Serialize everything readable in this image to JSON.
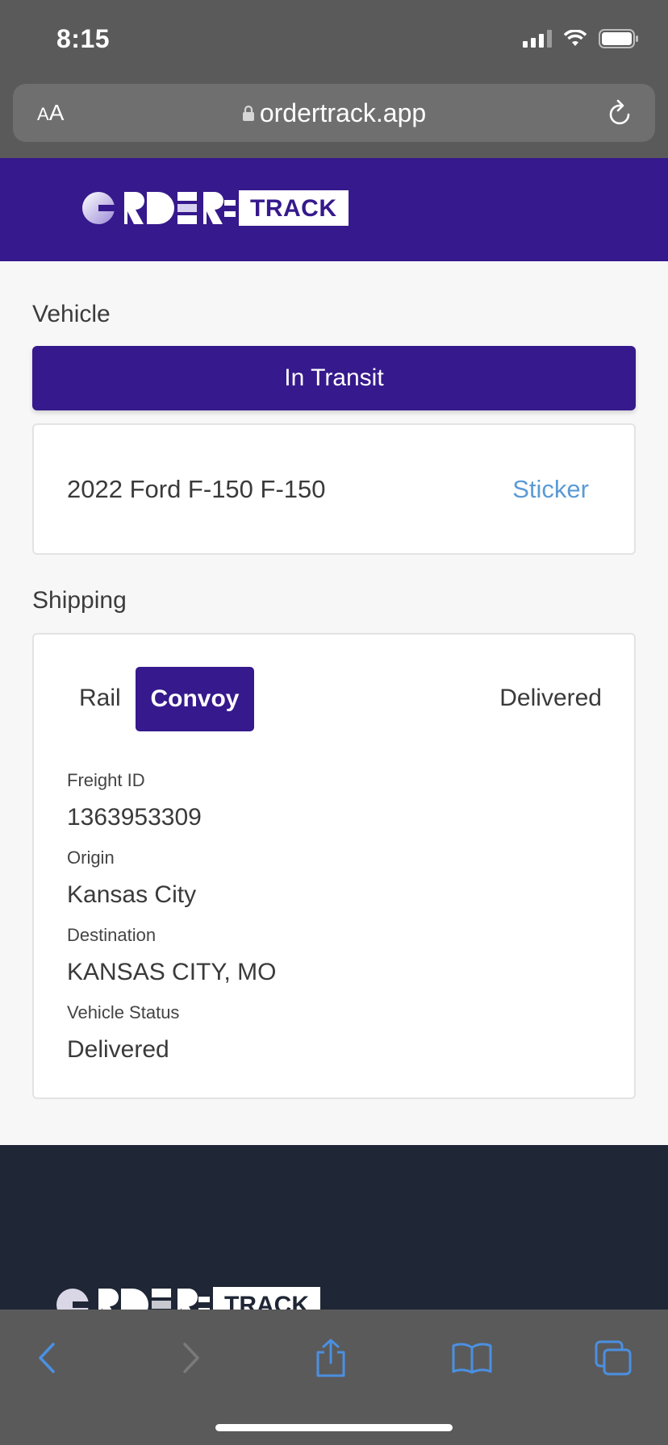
{
  "status_bar": {
    "time": "8:15"
  },
  "browser": {
    "text_size_small": "A",
    "text_size_large": "A",
    "url": "ordertrack.app"
  },
  "brand": {
    "badge": "TRACK"
  },
  "vehicle": {
    "section_label": "Vehicle",
    "status_banner": "In Transit",
    "name": "2022 Ford F-150 F-150",
    "sticker_link": "Sticker"
  },
  "shipping": {
    "section_label": "Shipping",
    "tabs": [
      {
        "label": "Rail",
        "active": false
      },
      {
        "label": "Convoy",
        "active": true
      }
    ],
    "status": "Delivered",
    "fields": [
      {
        "label": "Freight ID",
        "value": "1363953309"
      },
      {
        "label": "Origin",
        "value": "Kansas City"
      },
      {
        "label": "Destination",
        "value": "KANSAS CITY, MO"
      },
      {
        "label": "Vehicle Status",
        "value": "Delivered"
      }
    ]
  },
  "colors": {
    "brand": "#36198c",
    "link": "#5b9bd5",
    "footer": "#1f2635",
    "toolbar_icon": "#4a90e2"
  },
  "toolbar": {
    "icons": [
      "back-icon",
      "forward-icon",
      "share-icon",
      "bookmarks-icon",
      "tabs-icon"
    ]
  }
}
